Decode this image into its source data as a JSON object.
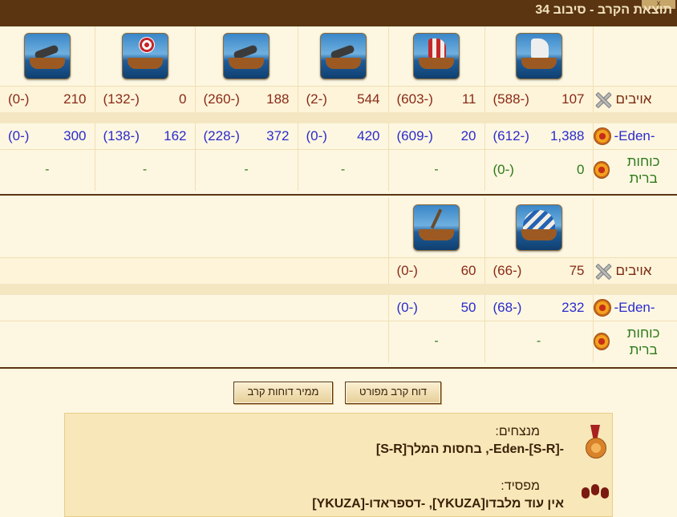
{
  "window": {
    "title": "תוצאת הקרב - סיבוב 34",
    "close_label": "x"
  },
  "labels": {
    "enemies": "אויבים",
    "eden": "-Eden-",
    "allies": "כוחות ברית"
  },
  "section1": {
    "units": [
      {
        "icon": "sail-ship-icon"
      },
      {
        "icon": "ram-ship-icon"
      },
      {
        "icon": "cannon-ship-icon"
      },
      {
        "icon": "ballista-ship-icon"
      },
      {
        "icon": "catapult-ship-icon"
      },
      {
        "icon": "mortar-ship-icon"
      }
    ],
    "enemies": [
      {
        "count": "107",
        "loss": "(-588)"
      },
      {
        "count": "11",
        "loss": "(-603)"
      },
      {
        "count": "544",
        "loss": "(-2)"
      },
      {
        "count": "188",
        "loss": "(-260)"
      },
      {
        "count": "0",
        "loss": "(-132)"
      },
      {
        "count": "210",
        "loss": "(-0)"
      }
    ],
    "eden": [
      {
        "count": "1,388",
        "loss": "(-612)"
      },
      {
        "count": "20",
        "loss": "(-609)"
      },
      {
        "count": "420",
        "loss": "(-0)"
      },
      {
        "count": "372",
        "loss": "(-228)"
      },
      {
        "count": "162",
        "loss": "(-138)"
      },
      {
        "count": "300",
        "loss": "(-0)"
      }
    ],
    "allies": [
      {
        "count": "0",
        "loss": "(-0)"
      },
      {
        "dash": "-"
      },
      {
        "dash": "-"
      },
      {
        "dash": "-"
      },
      {
        "dash": "-"
      },
      {
        "dash": "-"
      }
    ]
  },
  "section2": {
    "units": [
      {
        "icon": "paddle-steamer-icon"
      },
      {
        "icon": "tender-ship-icon"
      }
    ],
    "enemies": [
      {
        "count": "75",
        "loss": "(-66)"
      },
      {
        "count": "60",
        "loss": "(-0)"
      }
    ],
    "eden": [
      {
        "count": "232",
        "loss": "(-68)"
      },
      {
        "count": "50",
        "loss": "(-0)"
      }
    ],
    "allies": [
      {
        "dash": "-"
      },
      {
        "dash": "-"
      }
    ]
  },
  "buttons": {
    "detailed_report": "דוח קרב מפורט",
    "convert_reports": "ממיר דוחות קרב"
  },
  "result": {
    "winners_label": "מנצחים:",
    "winners_names": "-Eden-[S-R]-, בחסות המלך[S-R]",
    "loser_label": "מפסיד:",
    "loser_names": "אין עוד מלבדו[YKUZA], -דספראדו-[YKUZA]"
  }
}
